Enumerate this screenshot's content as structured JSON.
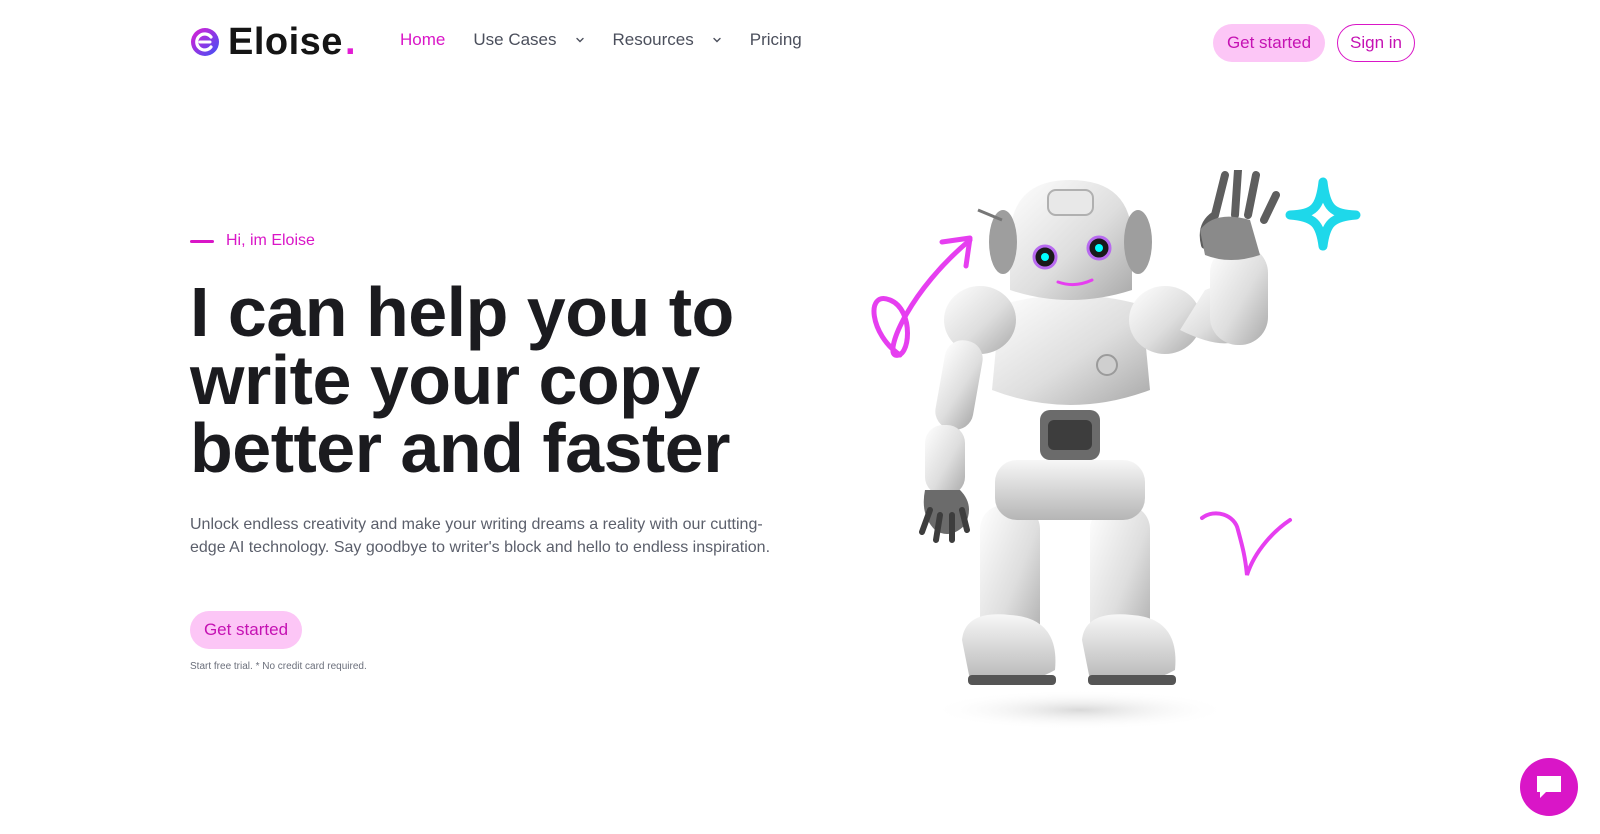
{
  "brand": {
    "name": "Eloise",
    "dot": ".",
    "accent_color": "#d916c7",
    "highlight_color": "#fcc6f6"
  },
  "nav": {
    "items": [
      {
        "label": "Home",
        "active": true,
        "dropdown": false
      },
      {
        "label": "Use Cases",
        "active": false,
        "dropdown": true
      },
      {
        "label": "Resources",
        "active": false,
        "dropdown": true
      },
      {
        "label": "Pricing",
        "active": false,
        "dropdown": false
      }
    ],
    "get_started_label": "Get started",
    "sign_in_label": "Sign in"
  },
  "hero": {
    "eyebrow": "Hi, im Eloise",
    "headline": "I can help you to write your copy better and faster",
    "lead": "Unlock endless creativity and make your writing dreams a reality with our cutting-edge AI technology. Say goodbye to writer's block and hello to endless inspiration.",
    "cta_label": "Get started",
    "note": "Start free trial. * No credit card required.",
    "illustration": "robot-waving-illustration"
  },
  "chat": {
    "icon": "chat-icon"
  }
}
